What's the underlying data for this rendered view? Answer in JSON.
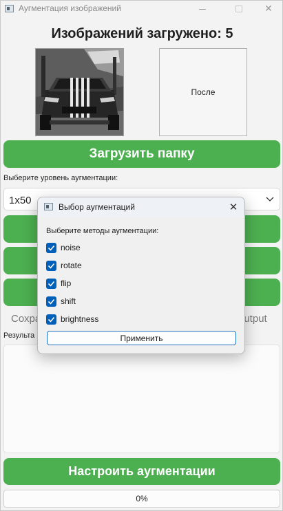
{
  "window": {
    "title": "Аугментация изображений",
    "close_glyph": "✕"
  },
  "header": {
    "title": "Изображений загружено: 5"
  },
  "preview": {
    "before_image": "car-photo",
    "after_label": "После"
  },
  "actions": {
    "load_folder_label": "Загрузить папку",
    "configure_label": "Настроить аугментации"
  },
  "level": {
    "label": "Выберите уровень аугментации:",
    "selected_value": "1x50"
  },
  "partially_hidden": {
    "left_text": "Сохра",
    "right_text": "output",
    "results_label": "Результа"
  },
  "progress": {
    "value": 0,
    "text": "0%"
  },
  "dialog": {
    "title": "Выбор аугментаций",
    "close_glyph": "✕",
    "prompt": "Выберите методы аугментации:",
    "options": [
      {
        "label": "noise",
        "checked": true
      },
      {
        "label": "rotate",
        "checked": true
      },
      {
        "label": "flip",
        "checked": true
      },
      {
        "label": "shift",
        "checked": true
      },
      {
        "label": "brightness",
        "checked": true
      }
    ],
    "apply_label": "Применить"
  },
  "colors": {
    "primary_green": "#4caf50",
    "checkbox_blue": "#005fb8"
  }
}
